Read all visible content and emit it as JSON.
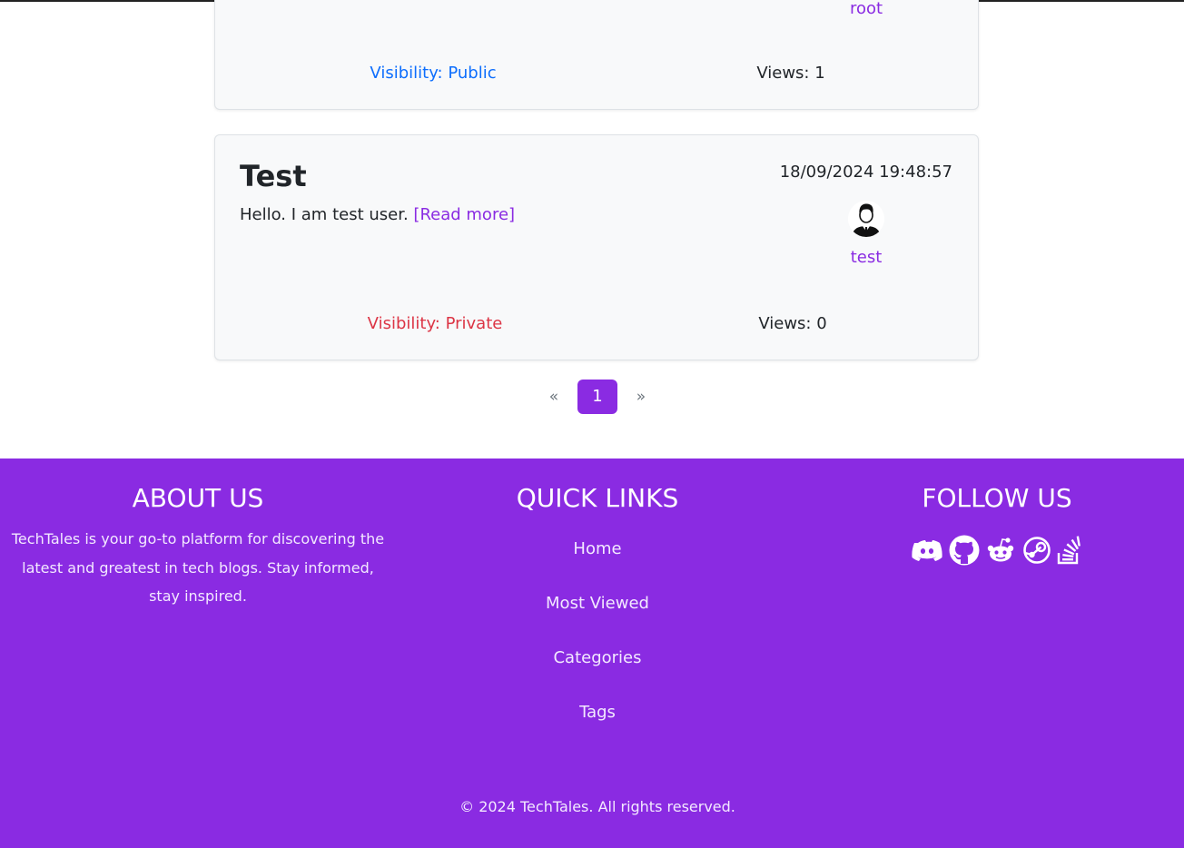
{
  "posts": [
    {
      "author": "root",
      "visibility": "Visibility: Public",
      "views": "Views: 1"
    },
    {
      "title": "Test",
      "excerpt": "Hello. I am test user.",
      "read_more": "[Read more]",
      "date": "18/09/2024 19:48:57",
      "author": "test",
      "visibility": "Visibility: Private",
      "views": "Views: 0"
    }
  ],
  "pagination": {
    "prev": "«",
    "current": "1",
    "next": "»"
  },
  "footer": {
    "about": {
      "heading": "ABOUT US",
      "text": "TechTales is your go-to platform for discovering the latest and greatest in tech blogs. Stay informed, stay inspired."
    },
    "quick_links": {
      "heading": "QUICK LINKS",
      "items": [
        "Home",
        "Most Viewed",
        "Categories",
        "Tags"
      ]
    },
    "follow": {
      "heading": "FOLLOW US",
      "icons": [
        "discord-icon",
        "github-icon",
        "reddit-icon",
        "steam-icon",
        "stackoverflow-icon"
      ]
    },
    "copyright": "© 2024 TechTales. All rights reserved."
  },
  "colors": {
    "accent": "#8a2be2",
    "public": "#0d6efd",
    "private": "#dc3545"
  }
}
